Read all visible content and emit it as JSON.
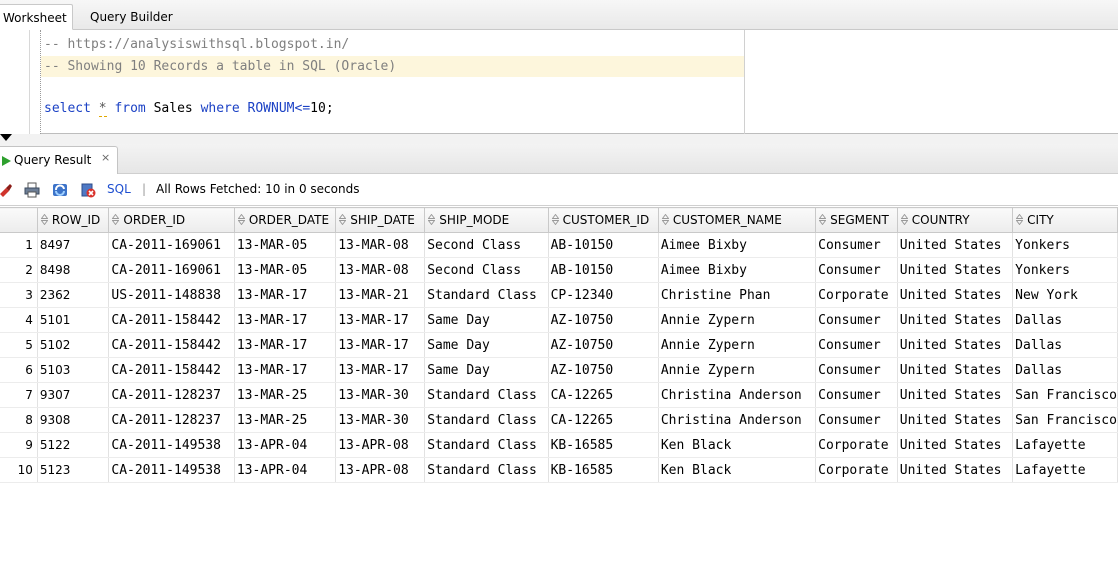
{
  "tabs": {
    "worksheet": "Worksheet",
    "query_builder": "Query Builder"
  },
  "editor": {
    "line1": "-- https://analysiswithsql.blogspot.in/",
    "line2": "-- Showing 10 Records a table in SQL (Oracle)",
    "sql": {
      "kw_select": "select",
      "star": "*",
      "kw_from": "from",
      "table": " Sales ",
      "kw_where": "where",
      "condition": " ROWNUM<=",
      "number": "10",
      "end": ";"
    }
  },
  "result": {
    "tab_label": "Query Result",
    "close": "×",
    "sql_link": "SQL",
    "separator": "|",
    "status": "All Rows Fetched: 10 in 0 seconds"
  },
  "grid": {
    "columns": [
      "ROW_ID",
      "ORDER_ID",
      "ORDER_DATE",
      "SHIP_DATE",
      "SHIP_MODE",
      "CUSTOMER_ID",
      "CUSTOMER_NAME",
      "SEGMENT",
      "COUNTRY",
      "CITY"
    ],
    "rows": [
      [
        "1",
        "8497",
        "CA-2011-169061",
        "13-MAR-05",
        "13-MAR-08",
        "Second Class",
        "AB-10150",
        "Aimee Bixby",
        "Consumer",
        "United States",
        "Yonkers"
      ],
      [
        "2",
        "8498",
        "CA-2011-169061",
        "13-MAR-05",
        "13-MAR-08",
        "Second Class",
        "AB-10150",
        "Aimee Bixby",
        "Consumer",
        "United States",
        "Yonkers"
      ],
      [
        "3",
        "2362",
        "US-2011-148838",
        "13-MAR-17",
        "13-MAR-21",
        "Standard Class",
        "CP-12340",
        "Christine Phan",
        "Corporate",
        "United States",
        "New York"
      ],
      [
        "4",
        "5101",
        "CA-2011-158442",
        "13-MAR-17",
        "13-MAR-17",
        "Same Day",
        "AZ-10750",
        "Annie Zypern",
        "Consumer",
        "United States",
        "Dallas"
      ],
      [
        "5",
        "5102",
        "CA-2011-158442",
        "13-MAR-17",
        "13-MAR-17",
        "Same Day",
        "AZ-10750",
        "Annie Zypern",
        "Consumer",
        "United States",
        "Dallas"
      ],
      [
        "6",
        "5103",
        "CA-2011-158442",
        "13-MAR-17",
        "13-MAR-17",
        "Same Day",
        "AZ-10750",
        "Annie Zypern",
        "Consumer",
        "United States",
        "Dallas"
      ],
      [
        "7",
        "9307",
        "CA-2011-128237",
        "13-MAR-25",
        "13-MAR-30",
        "Standard Class",
        "CA-12265",
        "Christina Anderson",
        "Consumer",
        "United States",
        "San Francisco"
      ],
      [
        "8",
        "9308",
        "CA-2011-128237",
        "13-MAR-25",
        "13-MAR-30",
        "Standard Class",
        "CA-12265",
        "Christina Anderson",
        "Consumer",
        "United States",
        "San Francisco"
      ],
      [
        "9",
        "5122",
        "CA-2011-149538",
        "13-APR-04",
        "13-APR-08",
        "Standard Class",
        "KB-16585",
        "Ken Black",
        "Corporate",
        "United States",
        "Lafayette"
      ],
      [
        "10",
        "5123",
        "CA-2011-149538",
        "13-APR-04",
        "13-APR-08",
        "Standard Class",
        "KB-16585",
        "Ken Black",
        "Corporate",
        "United States",
        "Lafayette"
      ]
    ]
  },
  "colors": {
    "keyword": "#1c42c5",
    "comment": "#7f7f7f",
    "link": "#1f4fd0",
    "current_line": "#fdf6dc"
  }
}
